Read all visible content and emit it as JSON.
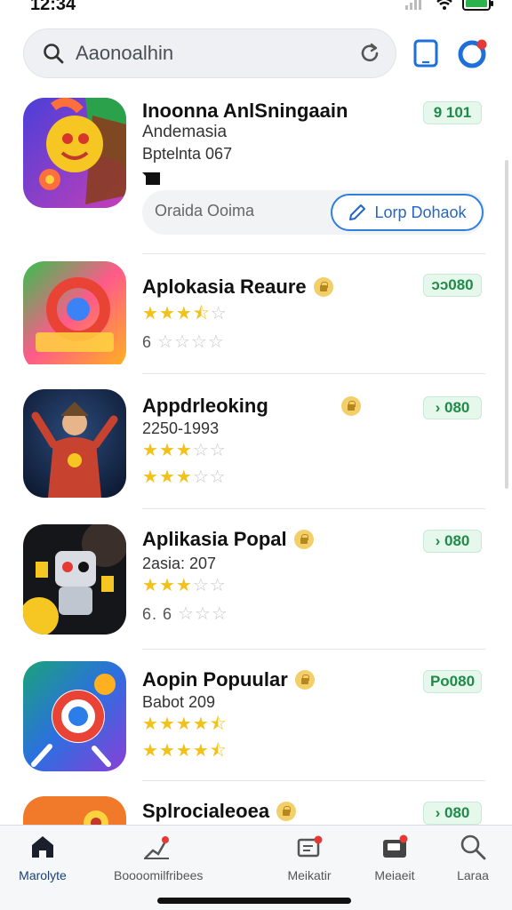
{
  "status": {
    "time": "12:34"
  },
  "search": {
    "placeholder": "Aaonoalhin"
  },
  "featured": {
    "title": "Inoonna AnlSningaain",
    "subtitle": "Andemasia",
    "meta": "Bptelnta 067",
    "price": "9 101",
    "action_hint": "Oraida Ooima",
    "action_button": "Lorp Dohaok"
  },
  "apps": [
    {
      "name": "Aplokasia Reaure",
      "price": "ɔɔ080",
      "line1": {
        "type": "stars",
        "on": 3,
        "half": 1,
        "off": 1
      },
      "line2": {
        "type": "stars",
        "lead": "6",
        "on": 0,
        "half": 0,
        "off": 4
      }
    },
    {
      "name": "Appdrleoking",
      "price": "› 080",
      "line1": {
        "type": "text",
        "text": "2250-1993"
      },
      "line2": {
        "type": "stars",
        "on": 3,
        "half": 0,
        "off": 2
      },
      "line3": {
        "type": "stars",
        "on": 3,
        "half": 0,
        "off": 2
      }
    },
    {
      "name": "Aplikasia Popal",
      "price": "› 080",
      "line1": {
        "type": "text",
        "text": "2asia: 207"
      },
      "line2": {
        "type": "stars",
        "on": 3,
        "half": 0,
        "off": 2
      },
      "line3": {
        "type": "stars",
        "lead": "6. 6",
        "on": 0,
        "half": 0,
        "off": 3
      }
    },
    {
      "name": "Aopin Popuular",
      "price": "Po080",
      "line1": {
        "type": "text",
        "text": "Babot 209"
      },
      "line2": {
        "type": "stars",
        "on": 4,
        "half": 1,
        "off": 0
      },
      "line3": {
        "type": "stars",
        "on": 4,
        "half": 1,
        "off": 0
      }
    },
    {
      "name": "Splrocialeoea",
      "price": "› 080"
    }
  ],
  "nav": [
    {
      "label": "Marolyte",
      "icon": "home-icon",
      "active": true
    },
    {
      "label": "Boooomilfribees",
      "icon": "charts-icon",
      "active": false
    },
    {
      "label": "Meikatir",
      "icon": "news-icon",
      "active": false
    },
    {
      "label": "Meiaeit",
      "icon": "wallet-icon",
      "active": false
    },
    {
      "label": "Laraa",
      "icon": "search-icon",
      "active": false
    }
  ],
  "colors": {
    "accent": "#2f7fe0",
    "price_green": "#1f8a49",
    "star": "#f2c21b"
  }
}
